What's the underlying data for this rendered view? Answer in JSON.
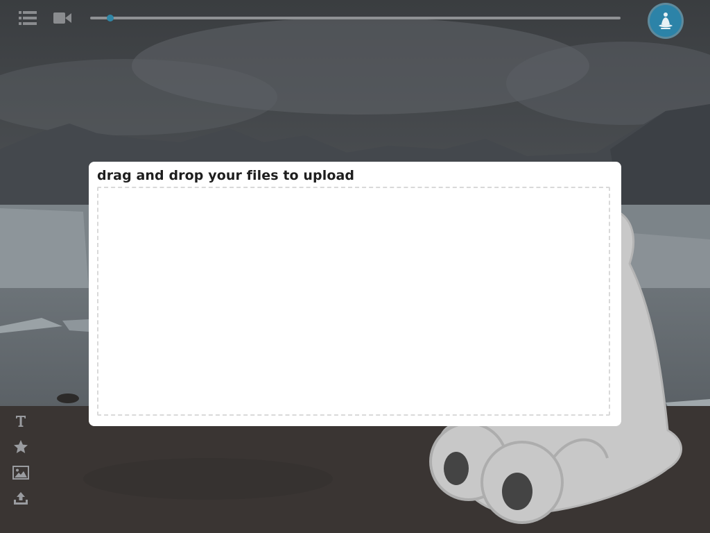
{
  "toolbar": {
    "list_icon": "list-icon",
    "video_icon": "video-camera-icon",
    "timeline_progress": 0.038,
    "avatar_icon": "meditating-figure-icon",
    "accent_color": "#2c83a8"
  },
  "upload_dialog": {
    "title": "drag and drop your files to upload"
  },
  "left_tools": {
    "items": [
      {
        "icon": "text-icon"
      },
      {
        "icon": "star-icon"
      },
      {
        "icon": "image-icon"
      },
      {
        "icon": "upload-icon"
      }
    ]
  }
}
